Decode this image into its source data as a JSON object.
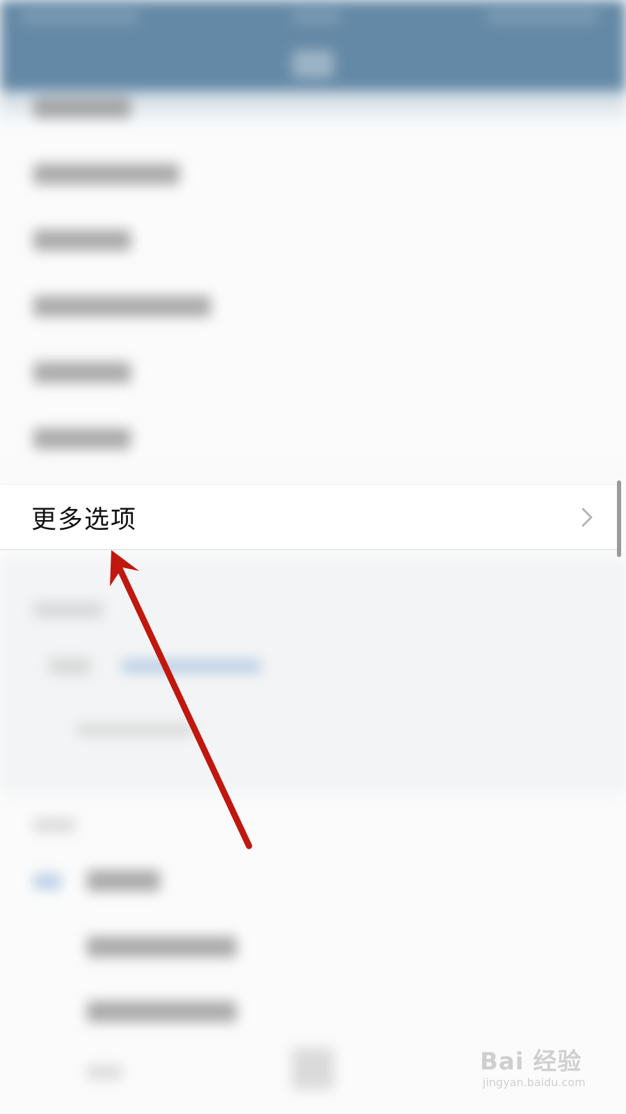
{
  "menu": {
    "more_options_label": "更多选项"
  },
  "icons": {
    "chevron": "chevron-right-icon",
    "annotation": "red-arrow-icon"
  },
  "colors": {
    "header": "#6489a6",
    "annotation_arrow": "#c0170f",
    "chevron": "#b3b3b3"
  },
  "watermark": {
    "brand": "Bai 经验",
    "url": "jingyan.baidu.com"
  }
}
